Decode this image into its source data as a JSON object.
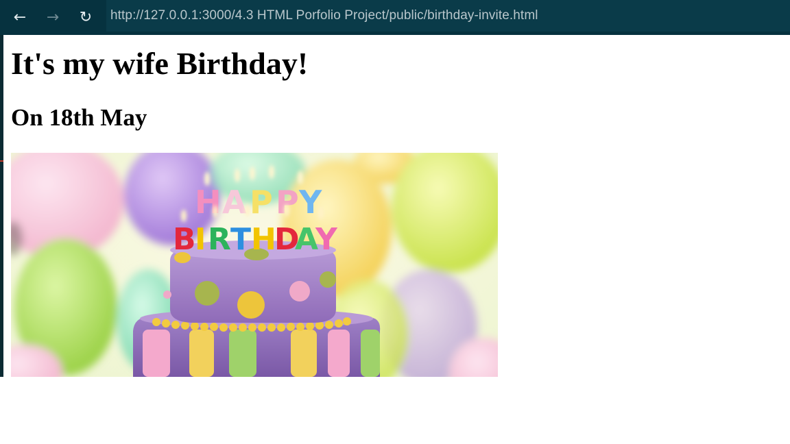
{
  "browser": {
    "back_icon": "arrow-left-icon",
    "forward_icon": "arrow-right-icon",
    "reload_icon": "reload-icon",
    "url": "http://127.0.0.1:3000/4.3 HTML Porfolio Project/public/birthday-invite.html"
  },
  "page": {
    "heading": "It's my wife Birthday!",
    "subheading": "On 18th May",
    "image": {
      "depicts": "birthday cake with happy birthday candles and balloons",
      "candle_text_top": "HAPPY",
      "candle_text_bottom": "BIRTHDAY"
    }
  }
}
